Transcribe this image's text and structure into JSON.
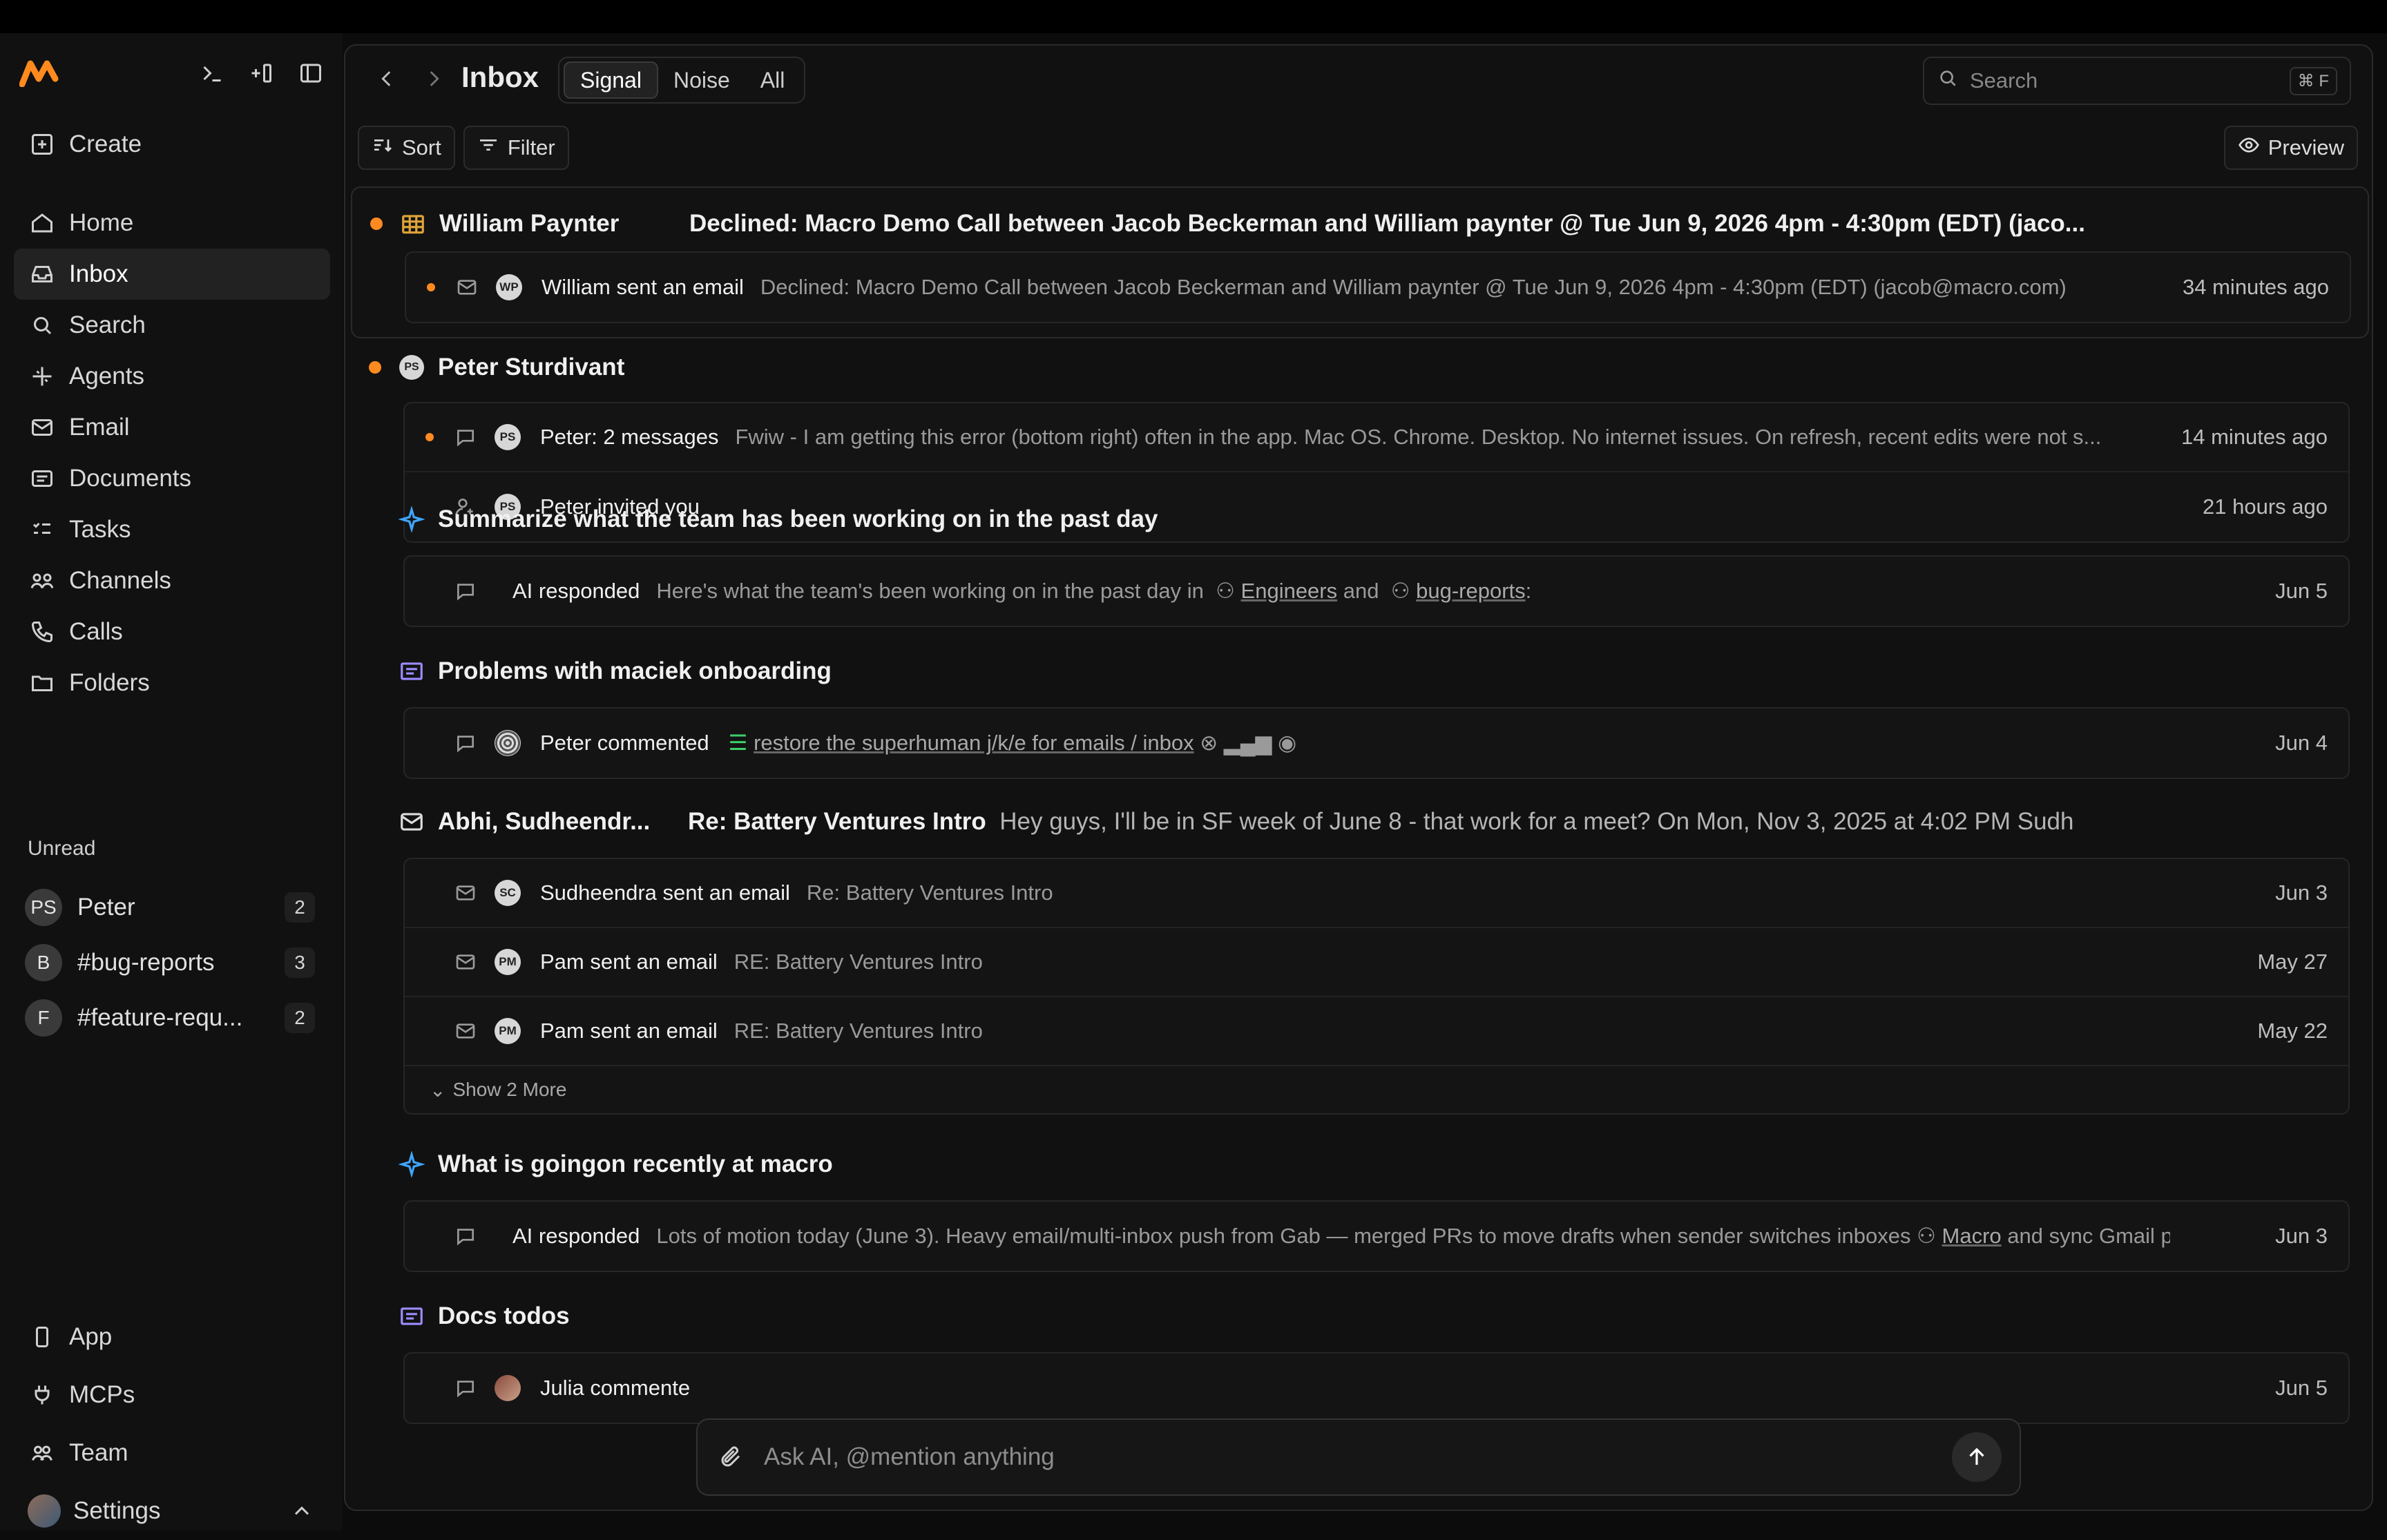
{
  "sidebar": {
    "logo": "macro-logo",
    "nav": [
      {
        "label": "Create",
        "icon": "plus-square-icon"
      },
      {
        "label": "Home",
        "icon": "home-icon"
      },
      {
        "label": "Inbox",
        "icon": "inbox-icon",
        "active": true
      },
      {
        "label": "Search",
        "icon": "search-icon"
      },
      {
        "label": "Agents",
        "icon": "sparkle-icon"
      },
      {
        "label": "Email",
        "icon": "mail-icon"
      },
      {
        "label": "Documents",
        "icon": "document-icon"
      },
      {
        "label": "Tasks",
        "icon": "tasks-icon"
      },
      {
        "label": "Channels",
        "icon": "channels-icon"
      },
      {
        "label": "Calls",
        "icon": "phone-icon"
      },
      {
        "label": "Folders",
        "icon": "folder-icon"
      }
    ],
    "unread_title": "Unread",
    "unread": [
      {
        "avatar": "PS",
        "name": "Peter",
        "count": "2"
      },
      {
        "avatar": "B",
        "name": "#bug-reports",
        "count": "3"
      },
      {
        "avatar": "F",
        "name": "#feature-requ...",
        "count": "2"
      }
    ],
    "bottom": [
      {
        "label": "App",
        "icon": "phone-device-icon"
      },
      {
        "label": "MCPs",
        "icon": "plug-icon"
      },
      {
        "label": "Team",
        "icon": "team-icon"
      },
      {
        "label": "Settings",
        "icon": "user-avatar"
      }
    ]
  },
  "header": {
    "title": "Inbox",
    "tabs": [
      "Signal",
      "Noise",
      "All"
    ],
    "search_placeholder": "Search",
    "search_kbd": "⌘ F"
  },
  "toolbar": {
    "sort": "Sort",
    "filter": "Filter",
    "preview": "Preview"
  },
  "groups": {
    "g1": {
      "name": "William Paynter",
      "subject": "Declined: Macro Demo Call between Jacob Beckerman and William paynter @ Tue Jun 9, 2026 4pm - 4:30pm (EDT) (jaco...",
      "rows": [
        {
          "avatar": "WP",
          "who": "William sent an email",
          "text": "Declined: Macro Demo Call between Jacob Beckerman and William paynter @ Tue Jun 9, 2026 4pm - 4:30pm (EDT) (jacob@macro.com)",
          "time": "34 minutes ago"
        }
      ]
    },
    "g2": {
      "name": "Peter Sturdivant",
      "avatar": "PS",
      "rows": [
        {
          "avatar": "PS",
          "who": "Peter: 2 messages",
          "text": "Fwiw - I am getting this error (bottom right) often in the app. Mac OS. Chrome. Desktop. No internet issues. On refresh, recent edits were not s...",
          "time": "14 minutes ago"
        },
        {
          "avatar": "PS",
          "who": "Peter invited you",
          "text": "",
          "time": "21 hours ago"
        }
      ]
    },
    "g3": {
      "name": "Summarize what the team has been working on in the past day",
      "row": {
        "who": "AI responded",
        "text": "Here's what the team's been working on in the past day in",
        "link1": "Engineers",
        "and": "and",
        "link2": "bug-reports",
        "colon": ":",
        "time": "Jun 5"
      }
    },
    "g4": {
      "name": "Problems with maciek onboarding",
      "row": {
        "who": "Peter commented",
        "link": "restore the superhuman j/k/e for emails / inbox",
        "time": "Jun 4"
      }
    },
    "g5": {
      "name": "Abhi, Sudheendr...",
      "subject": "Re: Battery Ventures Intro",
      "snippet": "Hey guys, I'll be in SF week of June 8 - that work for a meet? On Mon, Nov 3, 2025 at 4:02 PM Sudh",
      "rows": [
        {
          "avatar": "SC",
          "who": "Sudheendra sent an email",
          "text": "Re: Battery Ventures Intro",
          "time": "Jun 3"
        },
        {
          "avatar": "PM",
          "who": "Pam sent an email",
          "text": "RE: Battery Ventures Intro",
          "time": "May 27"
        },
        {
          "avatar": "PM",
          "who": "Pam sent an email",
          "text": "RE: Battery Ventures Intro",
          "time": "May 22"
        }
      ],
      "more": "Show 2 More"
    },
    "g6": {
      "name": "What is goingon recently at macro",
      "row": {
        "who": "AI responded",
        "text": "Lots of motion today (June 3). Heavy email/multi-inbox push from Gab — merged PRs to move drafts when sender switches inboxes",
        "link": "Macro",
        "after": "and sync Gmail pr...",
        "time": "Jun 3"
      }
    },
    "g7": {
      "name": "Docs todos",
      "row": {
        "who": "Julia commente",
        "time": "Jun 5"
      }
    }
  },
  "chat": {
    "placeholder": "Ask AI, @mention anything"
  },
  "colors": {
    "accent": "#ff8a1f",
    "ai": "#3fa6ff",
    "doc": "#9b8cff"
  }
}
